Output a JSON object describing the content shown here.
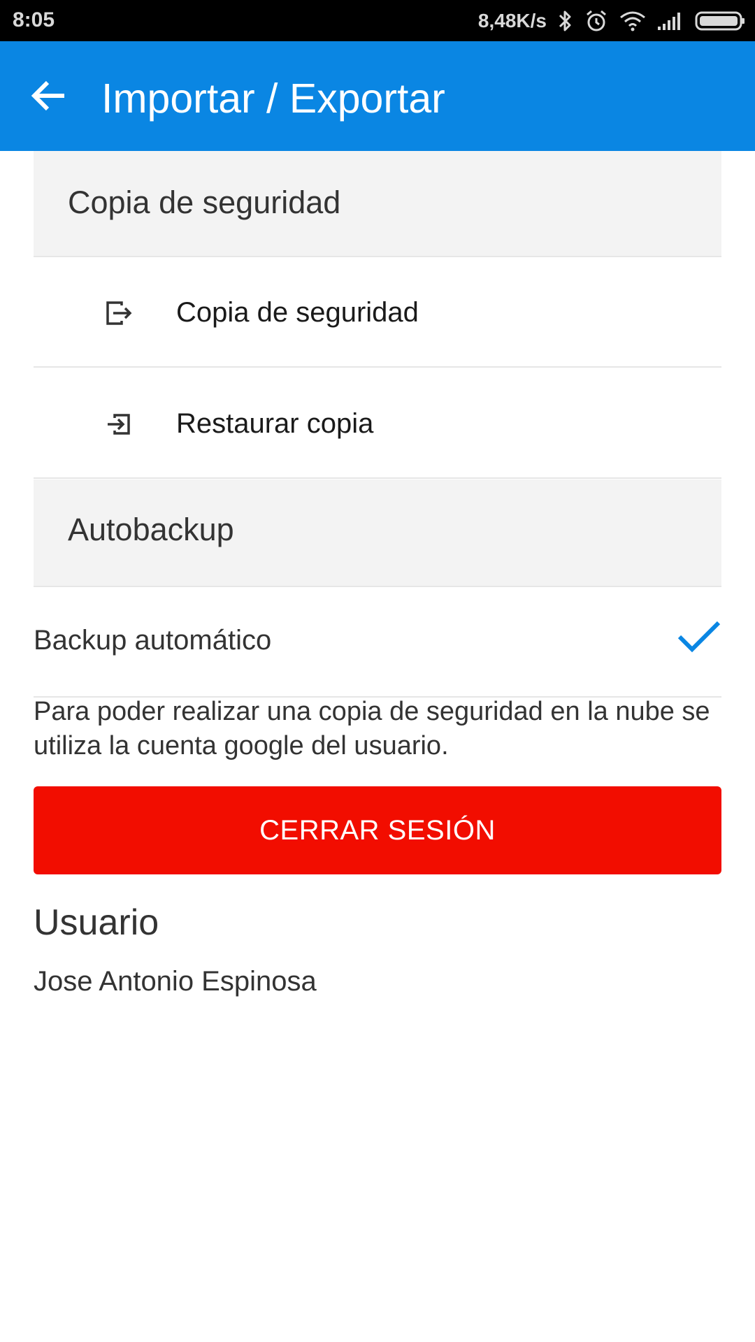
{
  "status_bar": {
    "time": "8:05",
    "net_speed": "8,48K/s",
    "icons": [
      "bluetooth-icon",
      "alarm-icon",
      "wifi-icon",
      "signal-icon",
      "battery-icon"
    ]
  },
  "app_bar": {
    "title": "Importar / Exportar",
    "back_icon": "arrow-left-icon",
    "color": "#0a86e3"
  },
  "sections": {
    "backup": {
      "header": "Copia de seguridad",
      "items": [
        {
          "label": "Copia de seguridad",
          "icon": "export-icon"
        },
        {
          "label": "Restaurar copia",
          "icon": "import-icon"
        }
      ]
    },
    "autobackup": {
      "header": "Autobackup",
      "toggle_label": "Backup automático",
      "checked": true,
      "check_color": "#0a86e3"
    }
  },
  "info_text": "Para poder realizar una copia de seguridad en la nube se utiliza la cuenta google del usuario.",
  "logout_button": {
    "label": "CERRAR SESIÓN",
    "color": "#f20d00"
  },
  "user": {
    "heading": "Usuario",
    "name": "Jose Antonio Espinosa"
  }
}
